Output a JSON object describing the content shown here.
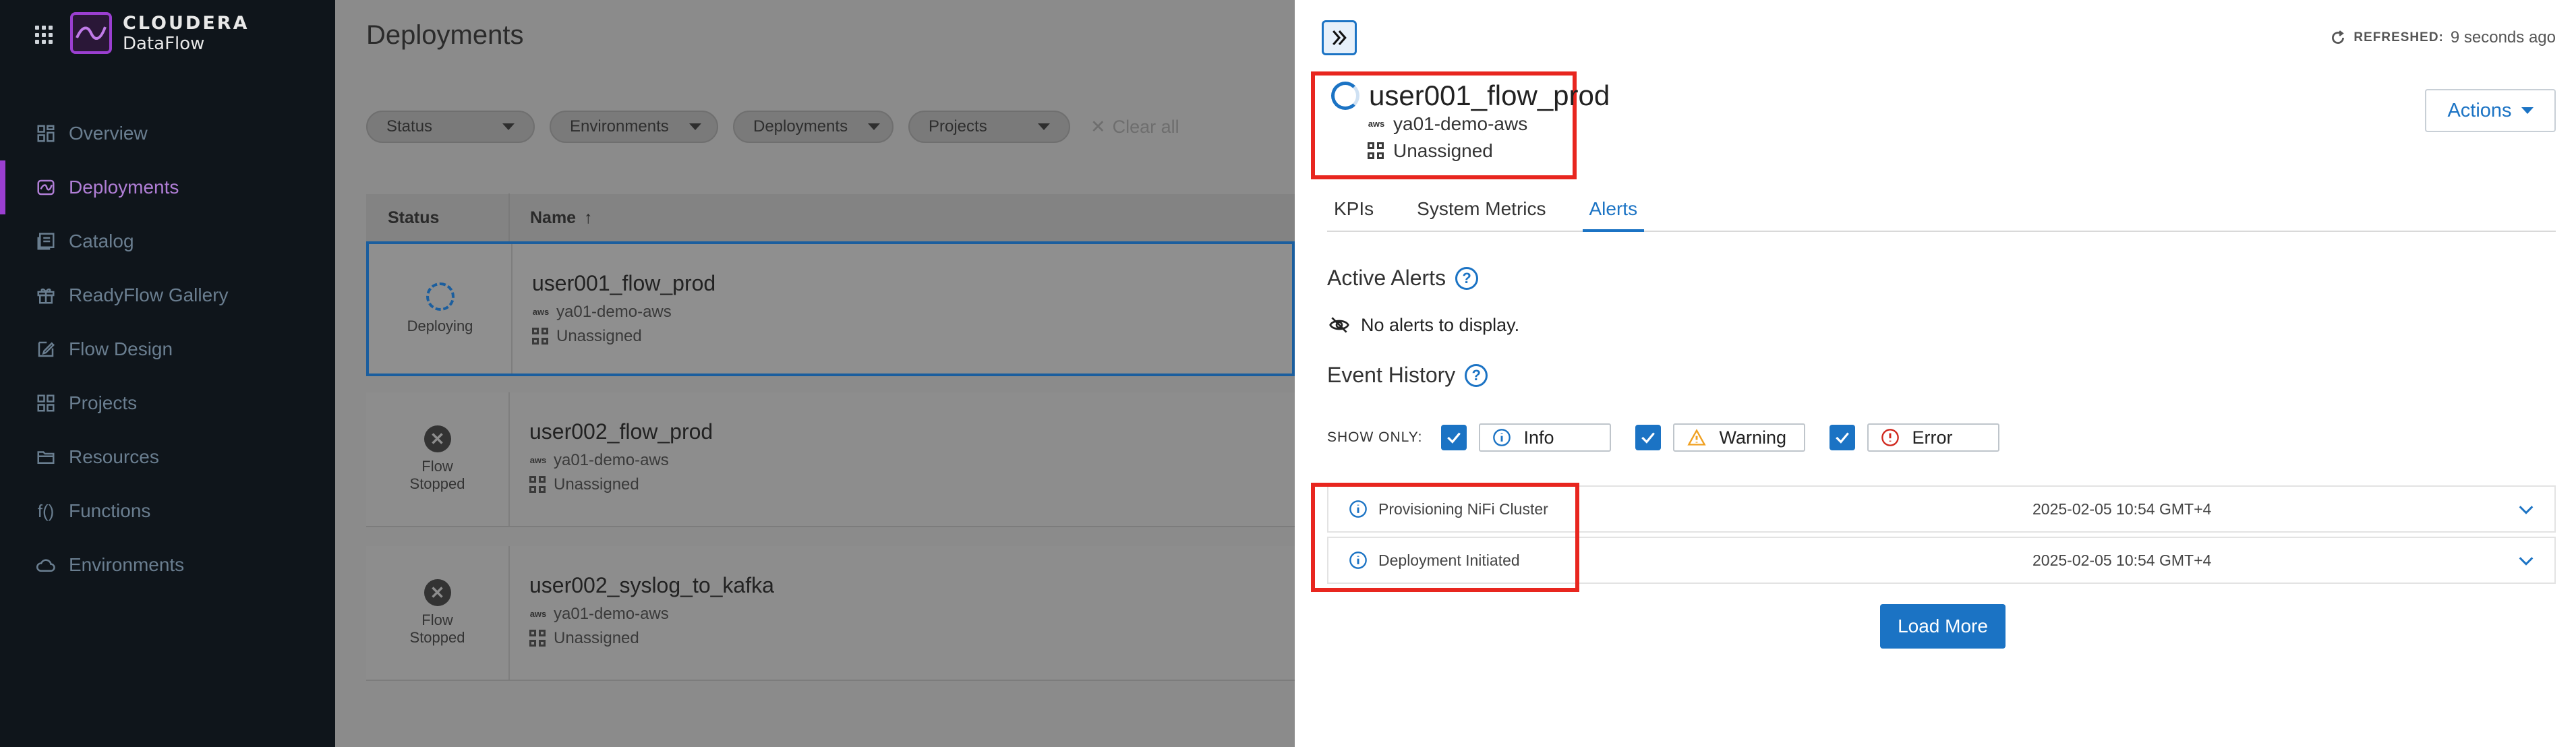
{
  "brand": {
    "line1": "CLOUDERA",
    "line2": "DataFlow",
    "accent_color": "#9b3fd1"
  },
  "sidebar": {
    "items": [
      {
        "label": "Overview",
        "icon": "dashboard-icon"
      },
      {
        "label": "Deployments",
        "icon": "deployments-icon",
        "active": true
      },
      {
        "label": "Catalog",
        "icon": "catalog-icon"
      },
      {
        "label": "ReadyFlow Gallery",
        "icon": "gift-icon"
      },
      {
        "label": "Flow Design",
        "icon": "edit-icon"
      },
      {
        "label": "Projects",
        "icon": "projects-icon"
      },
      {
        "label": "Resources",
        "icon": "folder-icon"
      },
      {
        "label": "Functions",
        "icon": "function-icon",
        "icon_text": "f()"
      },
      {
        "label": "Environments",
        "icon": "cloud-icon"
      }
    ]
  },
  "main": {
    "title": "Deployments",
    "filters": [
      "Status",
      "Environments",
      "Deployments",
      "Projects"
    ],
    "clear_all": "Clear all",
    "columns": {
      "status": "Status",
      "name": "Name"
    },
    "rows": [
      {
        "status": "Deploying",
        "name": "user001_flow_prod",
        "environment": "ya01-demo-aws",
        "project": "Unassigned"
      },
      {
        "status": "Flow Stopped",
        "name": "user002_flow_prod",
        "environment": "ya01-demo-aws",
        "project": "Unassigned"
      },
      {
        "status": "Flow Stopped",
        "name": "user002_syslog_to_kafka",
        "environment": "ya01-demo-aws",
        "project": "Unassigned"
      }
    ]
  },
  "drawer": {
    "refreshed_label": "REFRESHED:",
    "refreshed_value": "9 seconds ago",
    "flow_name": "user001_flow_prod",
    "environment": "ya01-demo-aws",
    "project": "Unassigned",
    "actions_label": "Actions",
    "tabs": [
      "KPIs",
      "System Metrics",
      "Alerts"
    ],
    "active_tab": "Alerts",
    "active_alerts_title": "Active Alerts",
    "no_alerts": "No alerts to display.",
    "event_history_title": "Event History",
    "show_only_label": "SHOW ONLY:",
    "filters": [
      "Info",
      "Warning",
      "Error"
    ],
    "events": [
      {
        "label": "Provisioning NiFi Cluster",
        "timestamp": "2025-02-05 10:54 GMT+4"
      },
      {
        "label": "Deployment Initiated",
        "timestamp": "2025-02-05 10:54 GMT+4"
      }
    ],
    "load_more": "Load More",
    "primary_color": "#1b73c4",
    "highlight_color": "#e8261f"
  }
}
